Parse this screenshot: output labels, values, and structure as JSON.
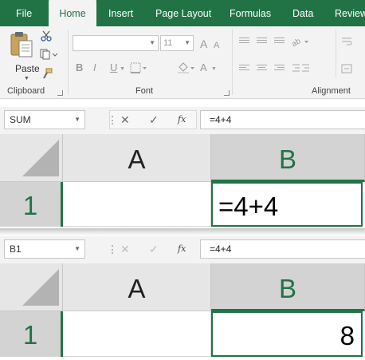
{
  "ribbon": {
    "tabs": [
      {
        "label": "File",
        "active": false
      },
      {
        "label": "Home",
        "active": true
      },
      {
        "label": "Insert",
        "active": false
      },
      {
        "label": "Page Layout",
        "active": false
      },
      {
        "label": "Formulas",
        "active": false
      },
      {
        "label": "Data",
        "active": false
      },
      {
        "label": "Review",
        "active": false
      }
    ],
    "clipboard": {
      "paste_label": "Paste",
      "group_label": "Clipboard"
    },
    "font": {
      "font_name": "",
      "font_size": "11",
      "group_label": "Font",
      "bold": "B",
      "italic": "I",
      "underline": "U",
      "grow": "A",
      "shrink": "A",
      "font_color": "A"
    },
    "alignment": {
      "group_label": "Alignment"
    }
  },
  "panels": [
    {
      "name_box": "SUM",
      "formula": "=4+4",
      "columns": [
        "A",
        "B"
      ],
      "row": "1",
      "cells": {
        "A1": "",
        "B1": "=4+4"
      },
      "active_cell": "B1"
    },
    {
      "name_box": "B1",
      "formula": "=4+4",
      "columns": [
        "A",
        "B"
      ],
      "row": "1",
      "cells": {
        "A1": "",
        "B1": "8"
      },
      "active_cell": "B1"
    }
  ],
  "formula_buttons": {
    "cancel": "✕",
    "enter": "✓",
    "insert_function": "fx"
  },
  "colors": {
    "accent": "#217346",
    "ribbon_bg": "#f3f3f3",
    "header_bg": "#e6e6e6",
    "selected_header_bg": "#d3d3d3"
  }
}
